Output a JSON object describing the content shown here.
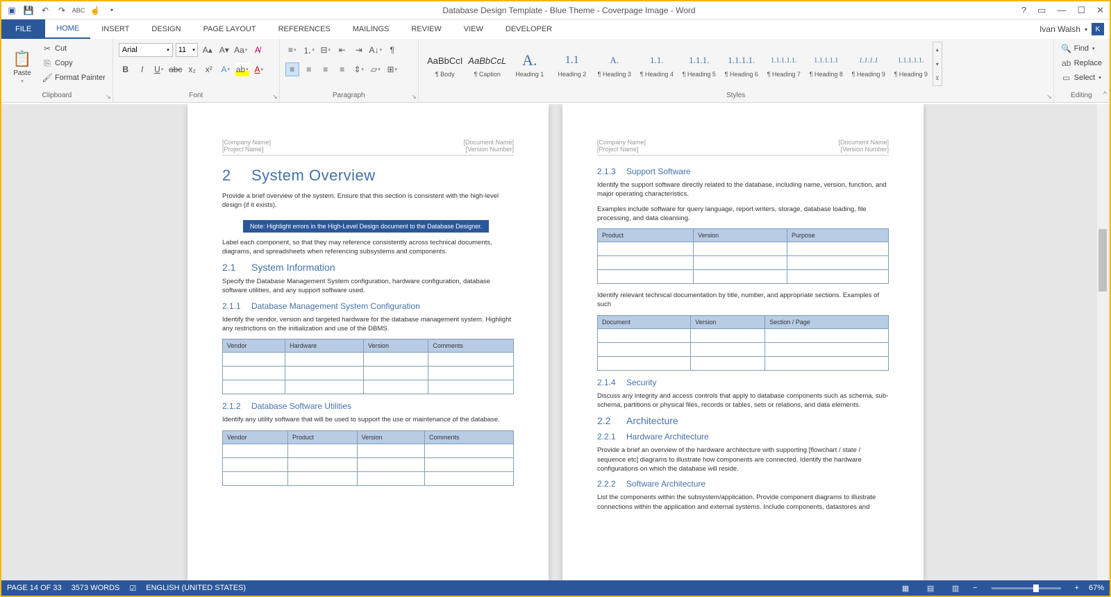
{
  "app": {
    "title": "Database Design Template - Blue Theme - Coverpage Image - Word",
    "user": "Ivan Walsh",
    "user_initial": "K"
  },
  "qat": [
    "word-icon",
    "save-icon",
    "undo-icon",
    "redo-icon",
    "spell-icon",
    "touch-icon"
  ],
  "tabs": [
    "FILE",
    "HOME",
    "INSERT",
    "DESIGN",
    "PAGE LAYOUT",
    "REFERENCES",
    "MAILINGS",
    "REVIEW",
    "VIEW",
    "DEVELOPER"
  ],
  "active_tab": "HOME",
  "clipboard": {
    "paste": "Paste",
    "cut": "Cut",
    "copy": "Copy",
    "fp": "Format Painter",
    "label": "Clipboard"
  },
  "font": {
    "name": "Arial",
    "size": "11",
    "label": "Font"
  },
  "paragraph": {
    "label": "Paragraph"
  },
  "styles": {
    "label": "Styles",
    "items": [
      {
        "preview": "AaBbCcI",
        "name": "¶ Body",
        "blue": false
      },
      {
        "preview": "AaBbCcL",
        "name": "¶ Caption",
        "blue": false,
        "italic": true
      },
      {
        "preview": "A.",
        "name": "Heading 1",
        "blue": true
      },
      {
        "preview": "1.1",
        "name": "Heading 2",
        "blue": true
      },
      {
        "preview": "A.",
        "name": "¶ Heading 3",
        "blue": true
      },
      {
        "preview": "1.1.",
        "name": "¶ Heading 4",
        "blue": true
      },
      {
        "preview": "1.1.1.",
        "name": "¶ Heading 5",
        "blue": true
      },
      {
        "preview": "1.1.1.1.",
        "name": "¶ Heading 6",
        "blue": true
      },
      {
        "preview": "1.1.1.1.1.",
        "name": "¶ Heading 7",
        "blue": true
      },
      {
        "preview": "1.1.1.1.1",
        "name": "¶ Heading 8",
        "blue": true
      },
      {
        "preview": "1.1.1.1",
        "name": "¶ Heading 9",
        "blue": true,
        "italic": true
      },
      {
        "preview": "1.1.1.1.1.",
        "name": "¶ Heading 9",
        "blue": true
      }
    ]
  },
  "editing": {
    "find": "Find",
    "replace": "Replace",
    "select": "Select",
    "label": "Editing"
  },
  "status": {
    "page": "PAGE 14 OF 33",
    "words": "3573 WORDS",
    "lang": "ENGLISH (UNITED STATES)",
    "zoom": "67%"
  },
  "doc": {
    "header": {
      "l1": "[Company Name]",
      "l2": "[Project Name]",
      "r1": "[Document Name]",
      "r2": "[Version Number]"
    },
    "left": {
      "h1_num": "2",
      "h1": "System Overview",
      "p1": "Provide a brief overview of the system. Ensure that this section is consistent with the high-level design (if it exists).",
      "note": "Note: Highlight errors in the High-Level Design document to the Database Designer.",
      "p2": "Label each component, so that they may reference consistently across technical documents, diagrams, and spreadsheets when referencing subsystems and components.",
      "h2a_num": "2.1",
      "h2a": "System Information",
      "p3": "Specify the Database Management System configuration, hardware configuration, database software utilities, and any support software used.",
      "h3a_num": "2.1.1",
      "h3a": "Database Management System Configuration",
      "p4": "Identify the vendor, version and targeted hardware for the database management system. Highlight any restrictions on the initialization and use of the DBMS.",
      "t1": [
        "Vendor",
        "Hardware",
        "Version",
        "Comments"
      ],
      "h3b_num": "2.1.2",
      "h3b": "Database Software Utilities",
      "p5": "Identify any utility software that will be used to support the use or maintenance of the database.",
      "t2": [
        "Vendor",
        "Product",
        "Version",
        "Comments"
      ]
    },
    "right": {
      "h3a_num": "2.1.3",
      "h3a": "Support Software",
      "p1": "Identify the support software directly related to the database, including name, version, function, and major operating characteristics.",
      "p2": "Examples include software for query language, report writers, storage, database loading, file processing, and data cleansing.",
      "t1": [
        "Product",
        "Version",
        "Purpose"
      ],
      "p3": "Identify relevant technical documentation by title, number, and appropriate sections. Examples of such",
      "t2": [
        "Document",
        "Version",
        "Section / Page"
      ],
      "h3b_num": "2.1.4",
      "h3b": "Security",
      "p4": "Discuss any integrity and access controls that apply to database components such as schema, sub-schema, partitions or physical files, records or tables, sets or relations, and data elements.",
      "h2a_num": "2.2",
      "h2a": "Architecture",
      "h3c_num": "2.2.1",
      "h3c": "Hardware Architecture",
      "p5": "Provide a brief an overview of the hardware architecture with supporting [flowchart / state / sequence etc] diagrams to illustrate how components are connected. Identify the hardware configurations on which the database will reside.",
      "h3d_num": "2.2.2",
      "h3d": "Software Architecture",
      "p6": "List the components within the subsystem/application. Provide component diagrams to illustrate connections within the application and external systems. Include components, datastores and"
    }
  }
}
